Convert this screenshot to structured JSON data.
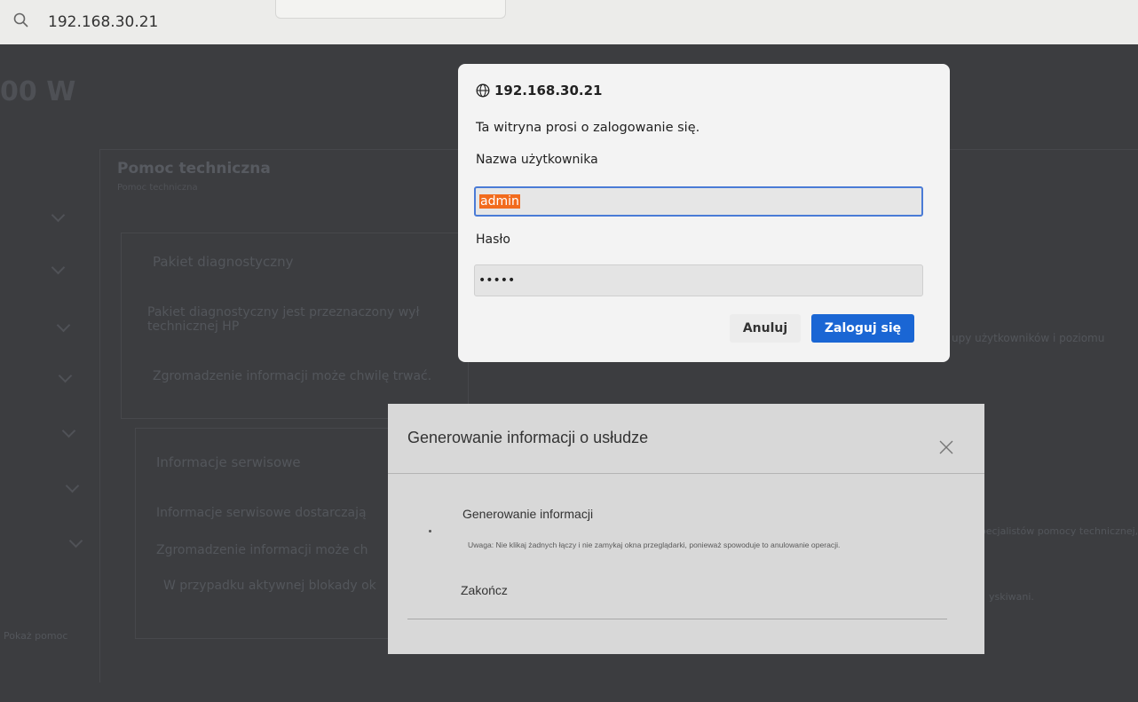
{
  "browser": {
    "url": "192.168.30.21"
  },
  "background": {
    "title_fragment": "00 W",
    "section_title": "Pomoc techniczna",
    "section_sub": "Pomoc techniczna",
    "diag_title": "Pakiet diagnostyczny",
    "diag_text1": "Pakiet diagnostyczny jest przeznaczony wył",
    "diag_text2": "technicznej HP",
    "diag_text3": "Zgromadzenie informacji może chwilę trwać.",
    "service_title": "Informacje serwisowe",
    "service_text1": "Informacje serwisowe dostarczają",
    "service_text2": "Zgromadzenie informacji może ch",
    "service_text3": "W przypadku aktywnej blokady ok",
    "right_text1": "upy użytkowników i poziomu",
    "right_text2": "specjalistów pomocy technicznej, kopiow",
    "right_text3": "yskiwani.",
    "left_bottom": "Pokaż pomoc"
  },
  "login_dialog": {
    "host": "192.168.30.21",
    "prompt": "Ta witryna prosi o zalogowanie się.",
    "username_label": "Nazwa użytkownika",
    "username_value": "admin",
    "password_label": "Hasło",
    "password_value": "•••••",
    "cancel_label": "Anuluj",
    "login_label": "Zaloguj się",
    "accent": "#1a66d4",
    "selection_color": "#f26b1d"
  },
  "generate_dialog": {
    "title": "Generowanie informacji o usłudze",
    "item": "Generowanie informacji",
    "note": "Uwaga: Nie klikaj żadnych łączy i nie zamykaj okna przeglądarki, ponieważ spowoduje to anulowanie operacji.",
    "finish": "Zakończ"
  }
}
